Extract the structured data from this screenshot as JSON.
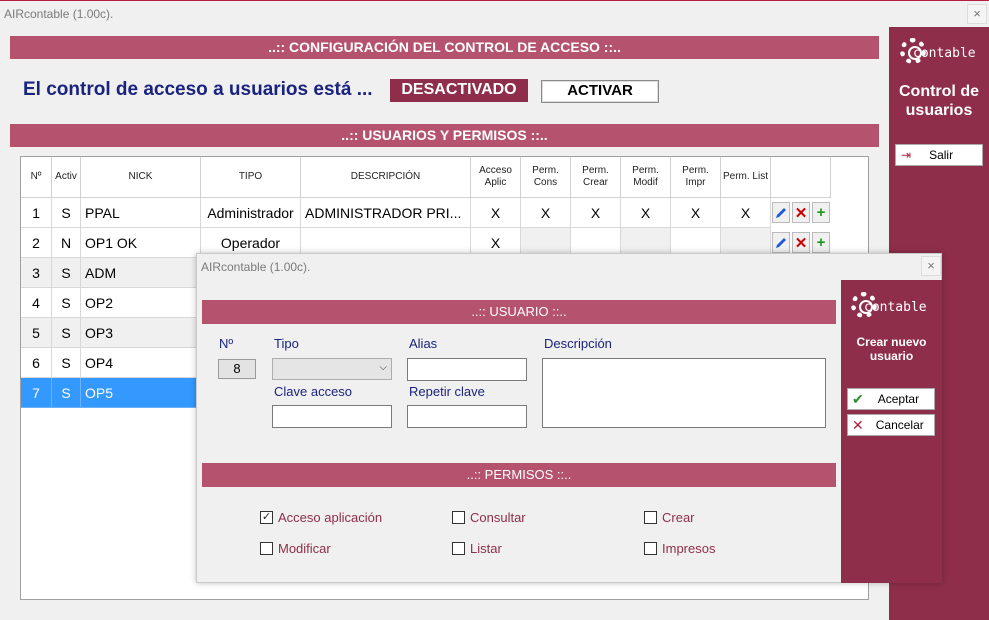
{
  "window": {
    "title": "AIRcontable (1.00c).",
    "close": "×"
  },
  "sections": {
    "config": "..:: CONFIGURACIÓN DEL CONTROL DE ACCESO ::..",
    "users": "..:: USUARIOS Y PERMISOS ::.."
  },
  "access_control": {
    "label": "El control de acceso a usuarios está ...",
    "status": "DESACTIVADO",
    "activate_button": "ACTIVAR"
  },
  "side_panel": {
    "logo": "contable",
    "title": "Control de usuarios",
    "exit_button": "Salir"
  },
  "table": {
    "headers": [
      "Nº",
      "Activ",
      "NICK",
      "TIPO",
      "DESCRIPCIÓN",
      "Acceso Aplic",
      "Perm. Cons",
      "Perm. Crear",
      "Perm. Modif",
      "Perm. Impr",
      "Perm. List"
    ],
    "rows": [
      {
        "n": "1",
        "activ": "S",
        "nick": "PPAL",
        "tipo": "Administrador",
        "desc": "ADMINISTRADOR PRI...",
        "acceso": "X",
        "cons": "X",
        "crear": "X",
        "modif": "X",
        "impr": "X",
        "list": "X"
      },
      {
        "n": "2",
        "activ": "N",
        "nick": "OP1 OK",
        "tipo": "Operador",
        "desc": "",
        "acceso": "X",
        "cons": "",
        "crear": "",
        "modif": "",
        "impr": "",
        "list": ""
      },
      {
        "n": "3",
        "activ": "S",
        "nick": "ADM"
      },
      {
        "n": "4",
        "activ": "S",
        "nick": "OP2"
      },
      {
        "n": "5",
        "activ": "S",
        "nick": "OP3"
      },
      {
        "n": "6",
        "activ": "S",
        "nick": "OP4"
      },
      {
        "n": "7",
        "activ": "S",
        "nick": "OP5"
      }
    ]
  },
  "dialog": {
    "title": "AIRcontable (1.00c).",
    "close": "×",
    "user_section": "..:: USUARIO ::..",
    "perm_section": "..:: PERMISOS ::..",
    "fields": {
      "numero_label": "Nº",
      "numero_value": "8",
      "tipo_label": "Tipo",
      "alias_label": "Alias",
      "descripcion_label": "Descripción",
      "clave_label": "Clave acceso",
      "repetir_label": "Repetir clave"
    },
    "permissions": [
      {
        "label": "Acceso aplicación",
        "checked": true
      },
      {
        "label": "Consultar",
        "checked": false
      },
      {
        "label": "Crear",
        "checked": false
      },
      {
        "label": "Modificar",
        "checked": false
      },
      {
        "label": "Listar",
        "checked": false
      },
      {
        "label": "Impresos",
        "checked": false
      }
    ],
    "side": {
      "logo": "contable",
      "title": "Crear nuevo usuario",
      "accept_button": "Aceptar",
      "cancel_button": "Cancelar"
    }
  },
  "colors": {
    "accent": "#8e2e4a",
    "banner": "#b5536e",
    "selected_row": "#3399ff",
    "label_blue": "#1a237e"
  }
}
